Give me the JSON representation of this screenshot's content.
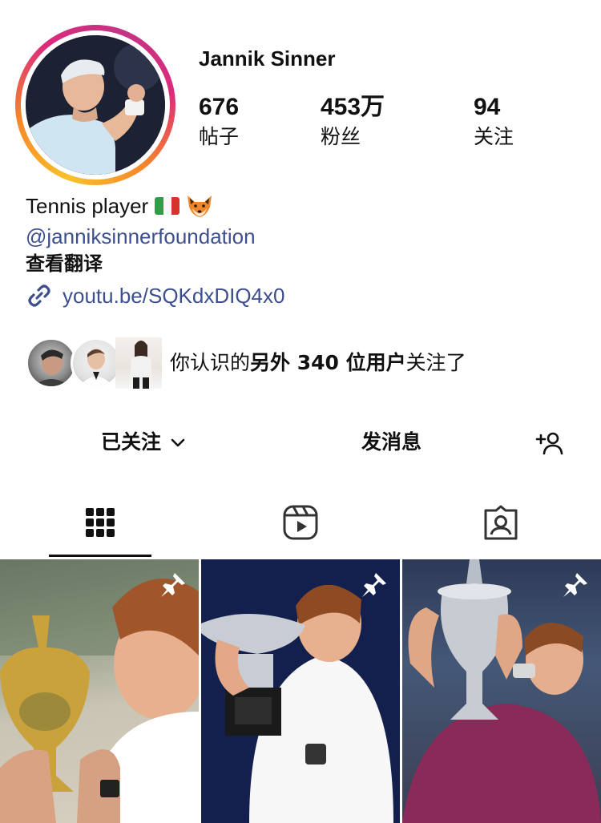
{
  "profile": {
    "display_name": "Jannik Sinner",
    "stats": {
      "posts": {
        "value": "676",
        "label": "帖子"
      },
      "followers": {
        "value": "453万",
        "label": "粉丝"
      },
      "following": {
        "value": "94",
        "label": "关注"
      }
    },
    "bio": {
      "text": "Tennis player",
      "emojis": [
        "italy-flag",
        "fox-face"
      ],
      "mention": "@janniksinnerfoundation",
      "translate_label": "查看翻译",
      "link": "youtu.be/SQKdxDIQ4x0"
    }
  },
  "mutual": {
    "prefix": "你认识的",
    "highlight": "另外 340 位用户",
    "suffix": "关注了"
  },
  "actions": {
    "following_label": "已关注",
    "message_label": "发消息"
  },
  "tabs": [
    {
      "name": "posts-grid",
      "icon": "grid-icon",
      "active": true
    },
    {
      "name": "reels",
      "icon": "reels-icon",
      "active": false
    },
    {
      "name": "tagged",
      "icon": "tagged-icon",
      "active": false
    }
  ],
  "posts": [
    {
      "pinned": true,
      "subject": "trophy-kiss"
    },
    {
      "pinned": true,
      "subject": "trophy-kiss"
    },
    {
      "pinned": true,
      "subject": "trophy-lift"
    }
  ],
  "colors": {
    "link": "#3d4f8f",
    "ring_start": "#f9c12b",
    "ring_end": "#c13584",
    "text": "#111111"
  }
}
